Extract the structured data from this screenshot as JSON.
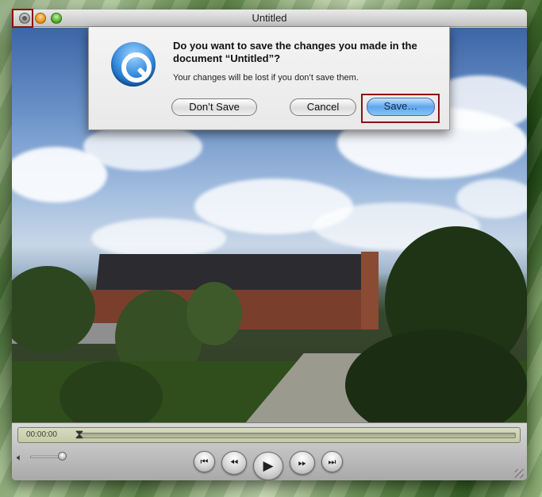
{
  "window": {
    "title": "Untitled"
  },
  "dialog": {
    "title": "Do you want to save the changes you made in the document “Untitled”?",
    "message": "Your changes will be lost if you don’t save them.",
    "dont_save_label": "Don’t Save",
    "cancel_label": "Cancel",
    "save_label": "Save…",
    "icon": "quicktime-icon"
  },
  "controls": {
    "time": "00:00:00",
    "icons": {
      "volume": "speaker-icon",
      "back": "step-back-icon",
      "rewind": "rewind-icon",
      "play": "play-icon",
      "forward": "fast-forward-icon",
      "end": "step-forward-icon"
    }
  },
  "colors": {
    "focus_highlight": "#8b1111",
    "default_button": "#5ea7ec",
    "timeline": "#c4c9a7"
  }
}
